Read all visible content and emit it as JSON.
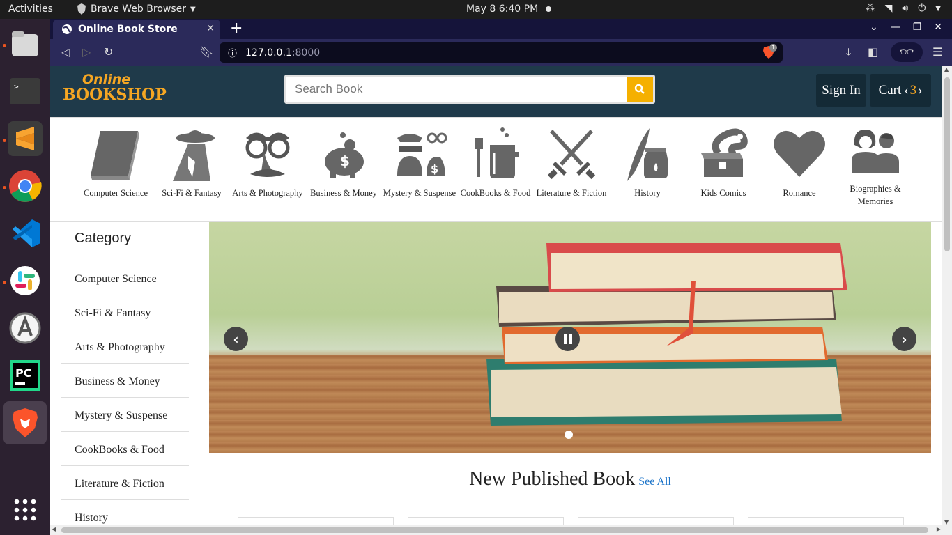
{
  "topbar": {
    "activities": "Activities",
    "app_menu": "Brave Web Browser",
    "clock": "May 8  6:40 PM"
  },
  "dock": {
    "apps": [
      "files-icon",
      "terminal-icon",
      "sublime-text-icon",
      "chrome-icon",
      "vscode-icon",
      "slack-icon",
      "software-center-icon",
      "pycharm-icon",
      "brave-icon",
      "show-apps-icon"
    ]
  },
  "browser": {
    "tab_title": "Online Book Store",
    "url_host": "127.0.0.1",
    "url_port": ":8000",
    "shield_count": "1"
  },
  "site": {
    "logo_top": "Online",
    "logo_bottom": "BOOKSHOP",
    "search_placeholder": "Search Book",
    "signin": "Sign In",
    "cart_label": "Cart",
    "cart_count": "3"
  },
  "categories": [
    {
      "label": "Computer Science",
      "icon": "book-icon"
    },
    {
      "label": "Sci-Fi & Fantasy",
      "icon": "ufo-icon"
    },
    {
      "label": "Arts & Photography",
      "icon": "disguise-glasses-icon"
    },
    {
      "label": "Business & Money",
      "icon": "piggy-bank-icon"
    },
    {
      "label": "Mystery & Suspense",
      "icon": "thief-icon"
    },
    {
      "label": "CookBooks & Food",
      "icon": "cooking-pot-icon"
    },
    {
      "label": "Literature & Fiction",
      "icon": "crossed-swords-icon"
    },
    {
      "label": "History",
      "icon": "quill-ink-icon"
    },
    {
      "label": "Kids Comics",
      "icon": "snake-chest-icon"
    },
    {
      "label": "Romance",
      "icon": "heart-icon"
    },
    {
      "label": "Biographies & Memories",
      "icon": "people-icon"
    }
  ],
  "sidebar": {
    "title": "Category",
    "items": [
      "Computer Science",
      "Sci-Fi & Fantasy",
      "Arts & Photography",
      "Business & Money",
      "Mystery & Suspense",
      "CookBooks & Food",
      "Literature & Fiction",
      "History"
    ]
  },
  "carousel": {
    "prev": "‹",
    "next": "›"
  },
  "new_published": {
    "title": "New Published Book",
    "see_all": "See All"
  }
}
